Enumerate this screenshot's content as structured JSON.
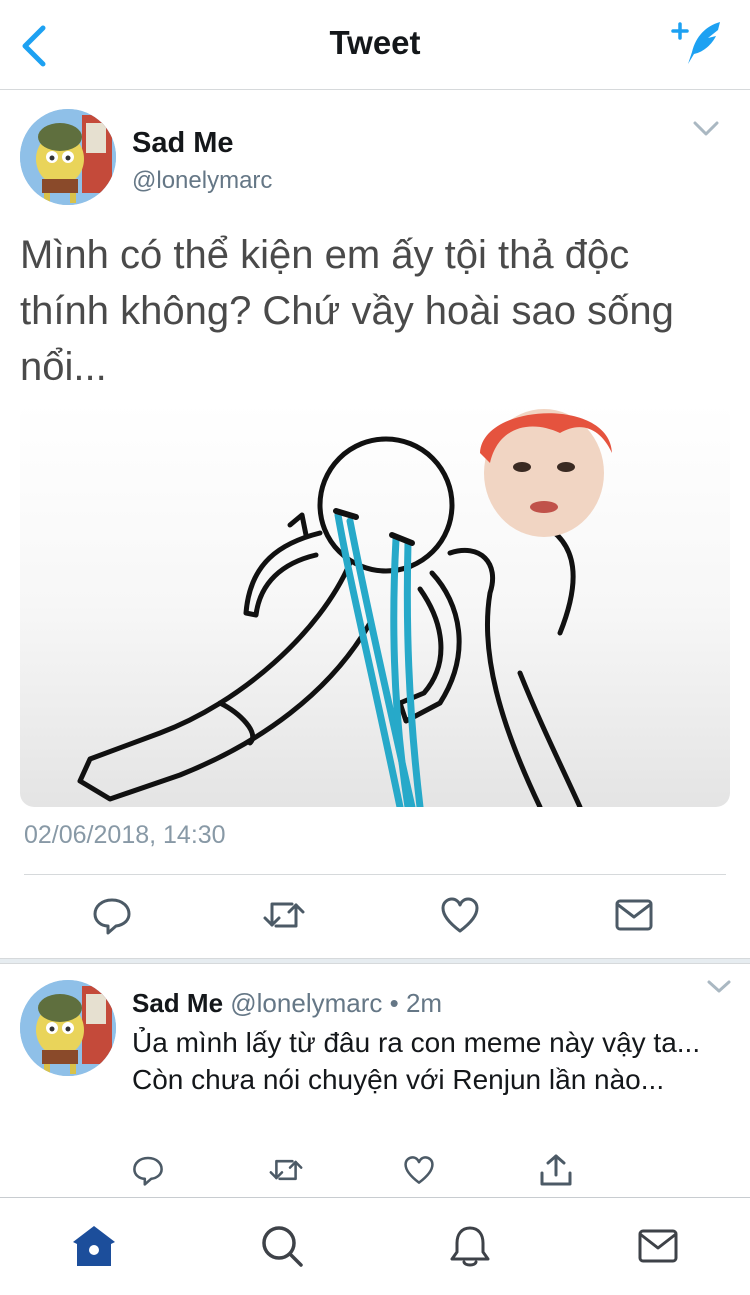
{
  "header": {
    "title": "Tweet",
    "back_icon": "chevron-left-icon",
    "compose_icon": "compose-feather-icon",
    "accent": "#1da1f2"
  },
  "main_tweet": {
    "author_name": "Sad Me",
    "author_handle": "@lonelymarc",
    "text": "Mình có thể kiện em ấy tội thả độc thính không? Chứ vầy hoài sao sống nổi...",
    "timestamp": "02/06/2018, 14:30",
    "actions": [
      "reply-icon",
      "retweet-icon",
      "like-icon",
      "message-icon"
    ]
  },
  "reply_tweet": {
    "author_name": "Sad Me",
    "author_handle": "@lonelymarc",
    "separator": " • ",
    "age": "2m",
    "text": "Ủa mình lấy từ đâu ra con meme này vậy ta... Còn chưa nói chuyện với Renjun lần nào...",
    "actions": [
      "reply-icon",
      "retweet-icon",
      "like-icon",
      "share-icon"
    ]
  },
  "tabbar": {
    "tabs": [
      "home-icon",
      "search-icon",
      "notifications-icon",
      "messages-icon"
    ],
    "active": "home-icon",
    "active_color": "#1c4e9b",
    "inactive_color": "#3e4248"
  }
}
